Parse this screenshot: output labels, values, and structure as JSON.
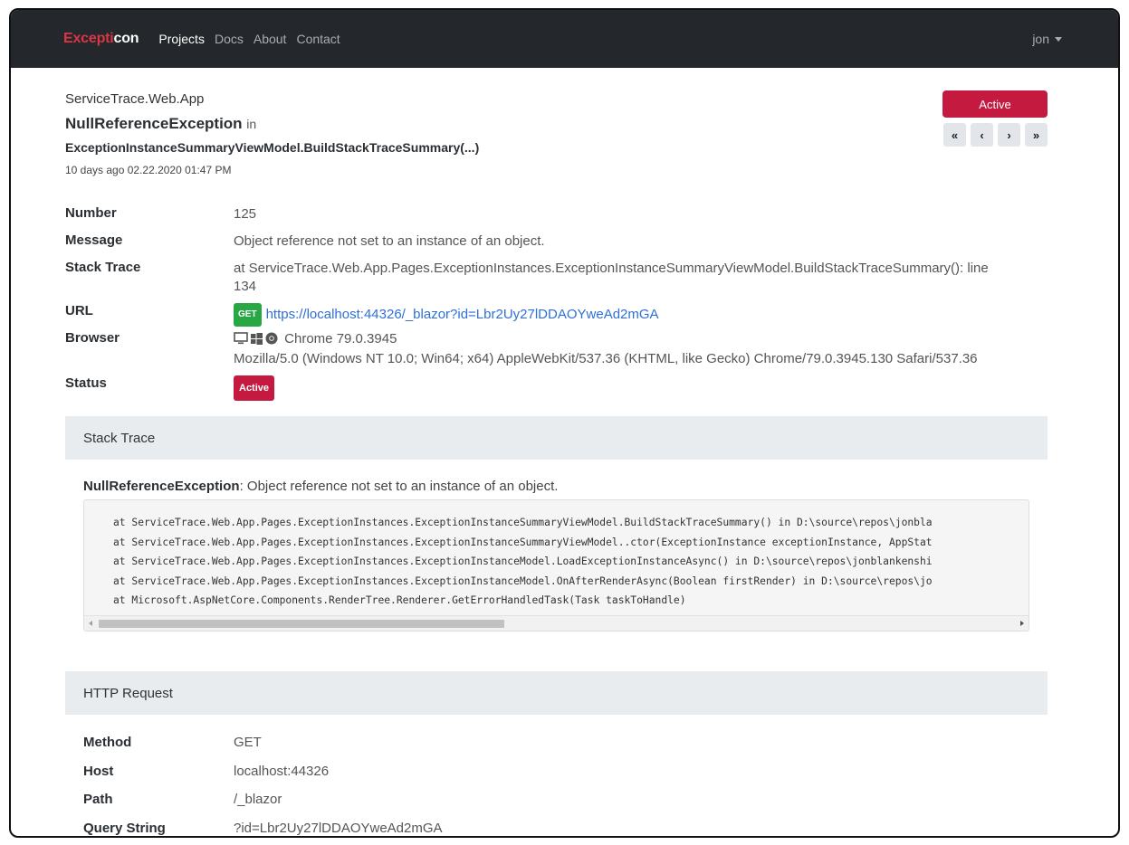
{
  "navbar": {
    "brand_part1": "Excepti",
    "brand_part2": "con",
    "links": [
      "Projects",
      "Docs",
      "About",
      "Contact"
    ],
    "active_link": "Projects",
    "user": "jon"
  },
  "header": {
    "app_name": "ServiceTrace.Web.App",
    "exception_type": "NullReferenceException",
    "in_word": "in",
    "method": "ExceptionInstanceSummaryViewModel.BuildStackTraceSummary(...)",
    "time": "10 days ago 02.22.2020 01:47 PM",
    "status_button": "Active",
    "pager": [
      "«",
      "‹",
      "›",
      "»"
    ]
  },
  "details": {
    "number_label": "Number",
    "number": "125",
    "message_label": "Message",
    "message": "Object reference not set to an instance of an object.",
    "stack_label": "Stack Trace",
    "stack_line1": "at ServiceTrace.Web.App.Pages.ExceptionInstances.ExceptionInstanceSummaryViewModel.BuildStackTraceSummary(): line",
    "stack_line2": "134",
    "url_label": "URL",
    "url_method": "GET",
    "url": "https://localhost:44326/_blazor?id=Lbr2Uy27lDDAOYweAd2mGA",
    "browser_label": "Browser",
    "browser_name": "Chrome 79.0.3945",
    "user_agent": "Mozilla/5.0 (Windows NT 10.0; Win64; x64) AppleWebKit/537.36 (KHTML, like Gecko) Chrome/79.0.3945.130 Safari/537.36",
    "status_label": "Status",
    "status": "Active"
  },
  "stack_trace_card": {
    "title": "Stack Trace",
    "exception": "NullReferenceException",
    "message": ": Object reference not set to an instance of an object.",
    "lines": [
      "at ServiceTrace.Web.App.Pages.ExceptionInstances.ExceptionInstanceSummaryViewModel.BuildStackTraceSummary() in D:\\source\\repos\\jonbla",
      "at ServiceTrace.Web.App.Pages.ExceptionInstances.ExceptionInstanceSummaryViewModel..ctor(ExceptionInstance exceptionInstance, AppStat",
      "at ServiceTrace.Web.App.Pages.ExceptionInstances.ExceptionInstanceModel.LoadExceptionInstanceAsync() in D:\\source\\repos\\jonblankenshi",
      "at ServiceTrace.Web.App.Pages.ExceptionInstances.ExceptionInstanceModel.OnAfterRenderAsync(Boolean firstRender) in D:\\source\\repos\\jo",
      "at Microsoft.AspNetCore.Components.RenderTree.Renderer.GetErrorHandledTask(Task taskToHandle)"
    ]
  },
  "http_request_card": {
    "title": "HTTP Request",
    "method_label": "Method",
    "method": "GET",
    "host_label": "Host",
    "host": "localhost:44326",
    "path_label": "Path",
    "path": "/_blazor",
    "query_label": "Query String",
    "query": "?id=Lbr2Uy27lDDAOYweAd2mGA"
  },
  "colors": {
    "brand_red": "#dc3545",
    "active_red": "#c51a3f",
    "get_green": "#28a745",
    "link_blue": "#2f6fd8",
    "navbar_bg": "#24272b"
  }
}
